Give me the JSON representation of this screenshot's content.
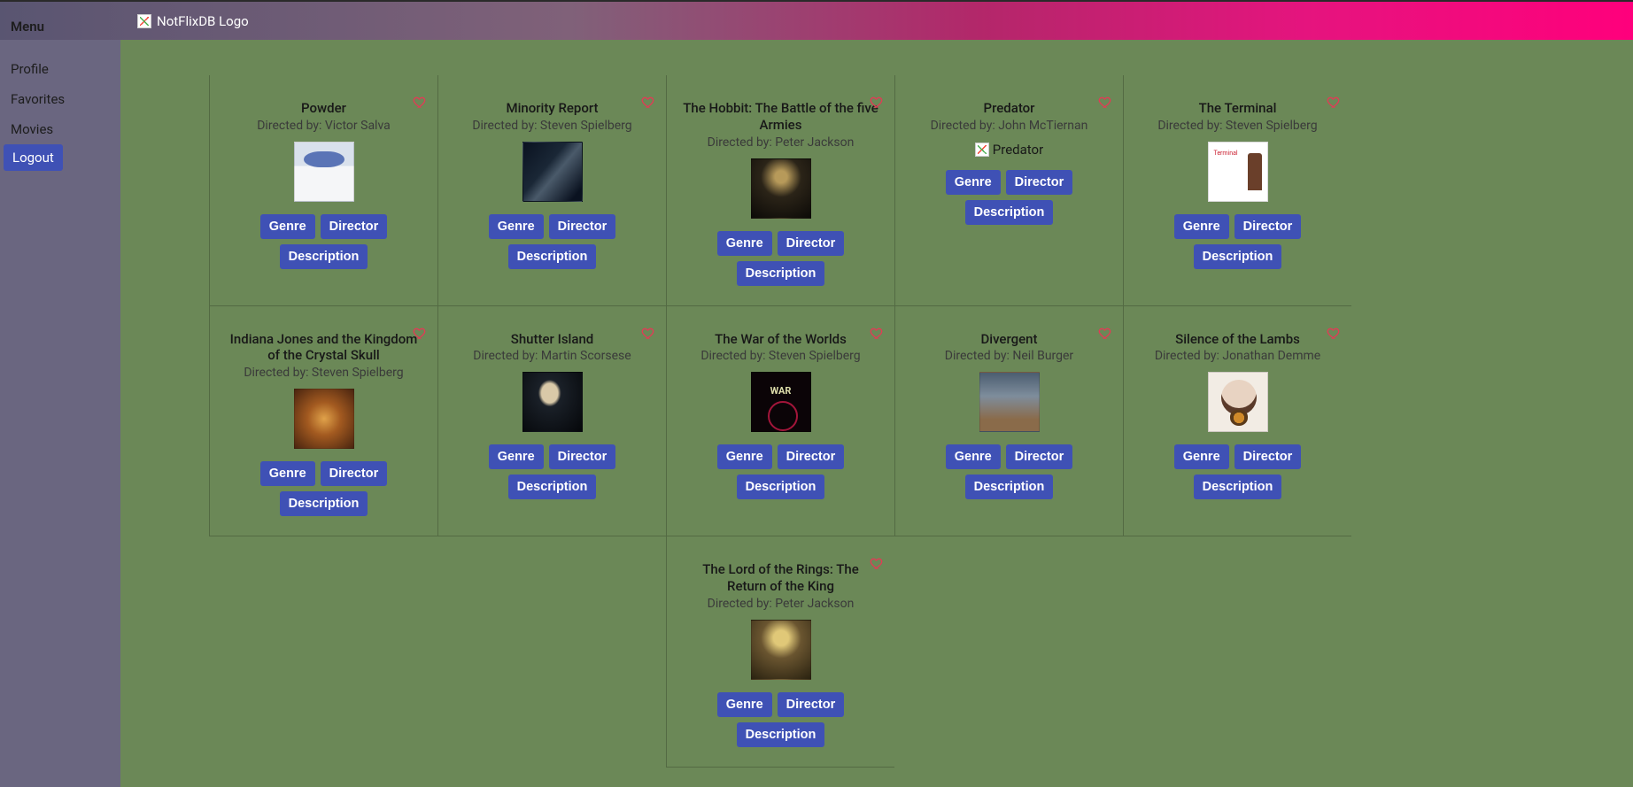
{
  "header": {
    "logo_alt": "NotFlixDB Logo"
  },
  "sidebar": {
    "title": "Menu",
    "items": [
      {
        "label": "Profile",
        "active": false
      },
      {
        "label": "Favorites",
        "active": false
      },
      {
        "label": "Movies",
        "active": false
      },
      {
        "label": "Logout",
        "active": true
      }
    ]
  },
  "buttons": {
    "genre": "Genre",
    "director": "Director",
    "description": "Description"
  },
  "directed_by_prefix": "Directed by: ",
  "movies": [
    {
      "title": "Powder",
      "director": "Victor Salva",
      "poster_class": "p-powder",
      "row": 0,
      "col": 0
    },
    {
      "title": "Minority Report",
      "director": "Steven Spielberg",
      "poster_class": "p-minority",
      "row": 0,
      "col": 1
    },
    {
      "title": "The Hobbit: The Battle of the five Armies",
      "director": "Peter Jackson",
      "poster_class": "p-hobbit",
      "row": 0,
      "col": 2
    },
    {
      "title": "Predator",
      "director": "John McTiernan",
      "poster_broken": true,
      "poster_alt": "Predator",
      "row": 0,
      "col": 3
    },
    {
      "title": "The Terminal",
      "director": "Steven Spielberg",
      "poster_class": "p-terminal",
      "row": 0,
      "col": 4
    },
    {
      "title": "Indiana Jones and the Kingdom of the Crystal Skull",
      "director": "Steven Spielberg",
      "poster_class": "p-indiana",
      "row": 1,
      "col": 0
    },
    {
      "title": "Shutter Island",
      "director": "Martin Scorsese",
      "poster_class": "p-shutter",
      "row": 1,
      "col": 1
    },
    {
      "title": "The War of the Worlds",
      "director": "Steven Spielberg",
      "poster_class": "p-war",
      "row": 1,
      "col": 2
    },
    {
      "title": "Divergent",
      "director": "Neil Burger",
      "poster_class": "p-divergent",
      "row": 1,
      "col": 3
    },
    {
      "title": "Silence of the Lambs",
      "director": "Jonathan Demme",
      "poster_class": "p-silence",
      "row": 1,
      "col": 4
    },
    {
      "title": "The Lord of the Rings: The Return of the King",
      "director": "Peter Jackson",
      "poster_class": "p-lotr",
      "row": 2,
      "col": 2
    }
  ]
}
